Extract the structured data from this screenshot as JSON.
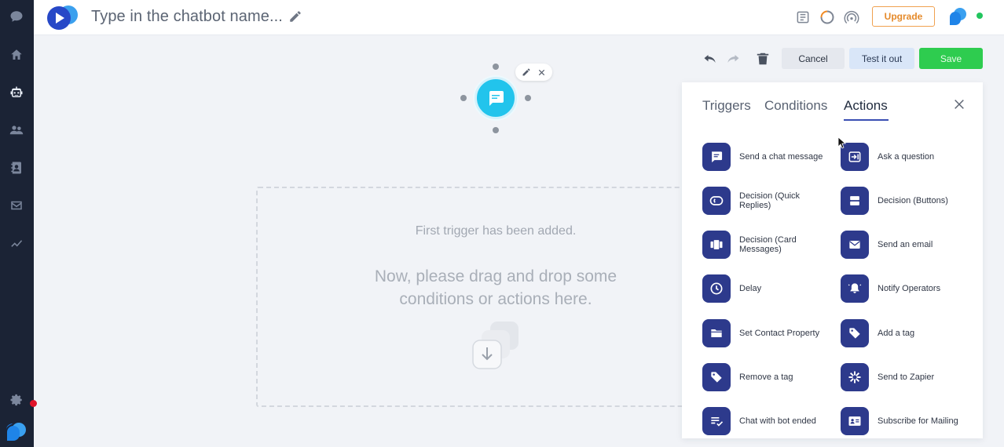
{
  "header": {
    "bot_name": "Type in the chatbot name...",
    "upgrade_label": "Upgrade"
  },
  "toolbar": {
    "cancel_label": "Cancel",
    "test_label": "Test it out",
    "save_label": "Save"
  },
  "canvas": {
    "hint_line1": "First trigger has been added.",
    "hint_line2": "Now, please drag and drop some conditions or actions here."
  },
  "panel": {
    "tabs": [
      {
        "label": "Triggers"
      },
      {
        "label": "Conditions"
      },
      {
        "label": "Actions",
        "active": true
      }
    ],
    "actions": [
      {
        "label": "Send a chat message",
        "icon": "chat-message-icon"
      },
      {
        "label": "Ask a question",
        "icon": "question-input-icon"
      },
      {
        "label": "Decision (Quick Replies)",
        "icon": "quick-replies-icon"
      },
      {
        "label": "Decision (Buttons)",
        "icon": "buttons-icon"
      },
      {
        "label": "Decision (Card Messages)",
        "icon": "card-messages-icon"
      },
      {
        "label": "Send an email",
        "icon": "envelope-icon"
      },
      {
        "label": "Delay",
        "icon": "clock-icon"
      },
      {
        "label": "Notify Operators",
        "icon": "bell-icon"
      },
      {
        "label": "Set Contact Property",
        "icon": "folder-icon"
      },
      {
        "label": "Add a tag",
        "icon": "tag-icon"
      },
      {
        "label": "Remove a tag",
        "icon": "tag-remove-icon"
      },
      {
        "label": "Send to Zapier",
        "icon": "zapier-icon"
      },
      {
        "label": "Chat with bot ended",
        "icon": "chat-ended-icon"
      },
      {
        "label": "Subscribe for Mailing",
        "icon": "contact-card-icon"
      }
    ]
  },
  "colors": {
    "sidebar_bg": "#1b2335",
    "action_icon_bg": "#2d3a8c",
    "save_green": "#2ecc4f",
    "upgrade_orange": "#e58a2a",
    "trigger_cyan": "#22c4ec"
  }
}
